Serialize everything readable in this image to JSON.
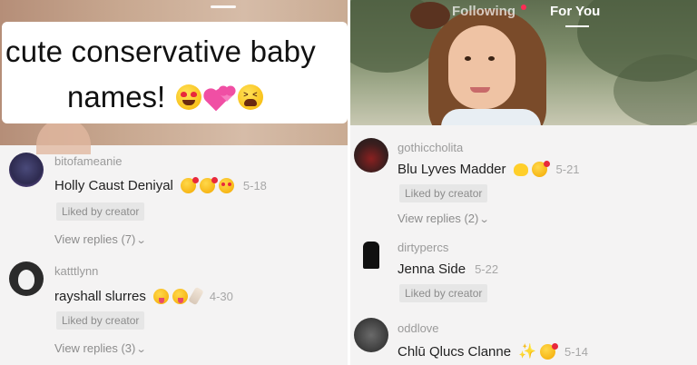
{
  "left": {
    "caption_line1": "cute conservative baby",
    "caption_line2": "names!",
    "comments": [
      {
        "username": "bitofameanie",
        "text": "Holly Caust Deniyal",
        "emojis": [
          "smiling-face-with-hearts",
          "smiling-face-with-hearts",
          "heart-eyes"
        ],
        "date": "5-18",
        "liked": "Liked by creator",
        "replies": "View replies (7)"
      },
      {
        "username": "katttlynn",
        "text": "rayshall slurres",
        "emojis": [
          "tongue-face",
          "tongue-face",
          "baby-bottle"
        ],
        "date": "4-30",
        "liked": "Liked by creator",
        "replies": "View replies (3)"
      }
    ]
  },
  "right": {
    "tabs": {
      "following": "Following",
      "for_you": "For You"
    },
    "comments": [
      {
        "username": "gothiccholita",
        "text": "Blu Lyves Madder",
        "emojis": [
          "chick",
          "smiling-face-with-hearts"
        ],
        "date": "5-21",
        "liked": "Liked by creator",
        "replies": "View replies (2)"
      },
      {
        "username": "dirtypercs",
        "text": "Jenna Side",
        "date": "5-22",
        "liked": "Liked by creator"
      },
      {
        "username": "oddlove",
        "text": "Chlū Qlucs Clanne",
        "emojis": [
          "sparkles",
          "smiling-face-with-hearts"
        ],
        "date": "5-14"
      }
    ]
  },
  "colors": {
    "notification_dot": "#fe2c55",
    "comment_bg": "#f4f3f3",
    "liked_badge_bg": "#e6e6e6"
  }
}
